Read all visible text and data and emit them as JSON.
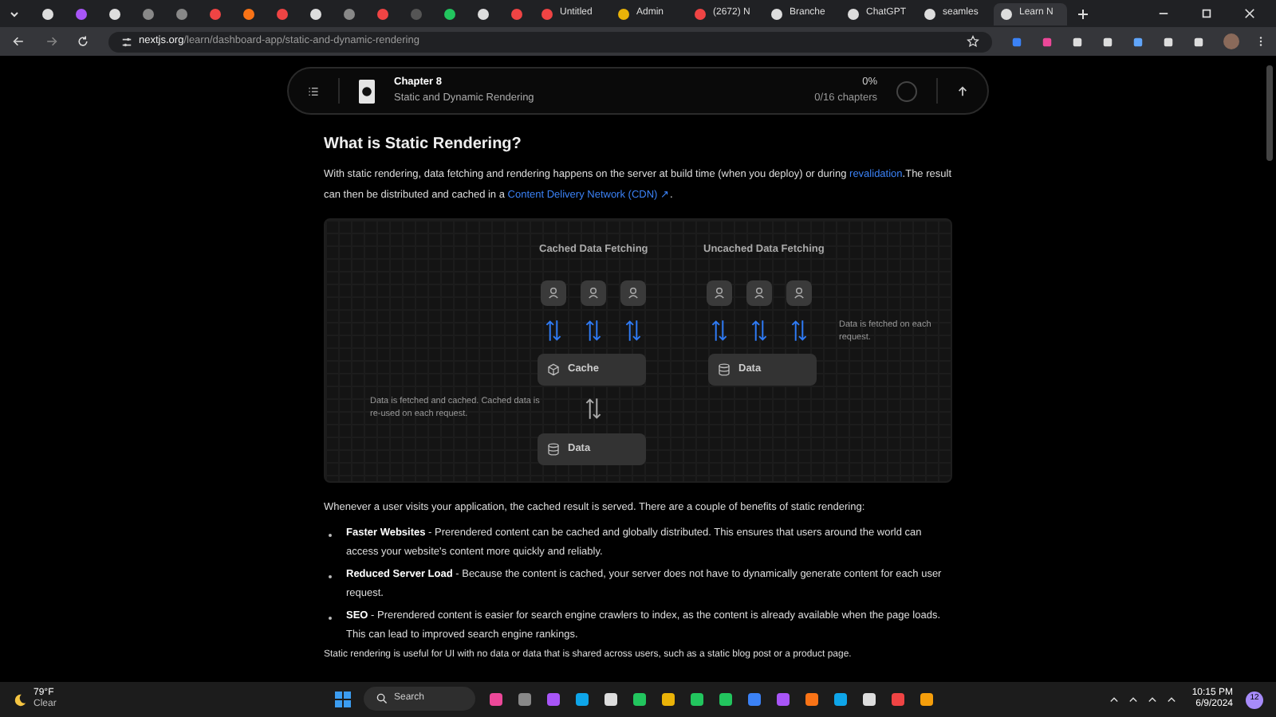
{
  "browser": {
    "tabs": [
      {
        "selected": false
      },
      {
        "selected": false
      },
      {
        "selected": false
      },
      {
        "selected": false
      },
      {
        "selected": false
      },
      {
        "selected": false
      },
      {
        "selected": false
      },
      {
        "selected": false
      },
      {
        "selected": false
      },
      {
        "selected": false
      },
      {
        "selected": false
      },
      {
        "selected": false
      },
      {
        "selected": false
      },
      {
        "selected": false
      },
      {
        "selected": false
      },
      {
        "label": "Untitled",
        "selected": false
      },
      {
        "label": "Admin",
        "selected": false
      },
      {
        "label": "(2672) N",
        "selected": false
      },
      {
        "label": "Branche",
        "selected": false
      },
      {
        "label": "ChatGPT",
        "selected": false
      },
      {
        "label": "seamles",
        "selected": false
      },
      {
        "label": "Learn N",
        "selected": true
      }
    ],
    "url_host": "nextjs.org",
    "url_path": "/learn/dashboard-app/static-and-dynamic-rendering"
  },
  "chapter_bar": {
    "chapter": "Chapter 8",
    "title": "Static and Dynamic Rendering",
    "progress": "0%",
    "count": "0/16 chapters"
  },
  "heading": "What is Static Rendering?",
  "intro": [
    {
      "text": "With static rendering, data fetching and rendering happens on the server at build time (when you deploy) or during ",
      "kind": "text"
    },
    {
      "text": "revalidation",
      "kind": "link"
    },
    {
      "text": ".",
      "kind": "text"
    },
    {
      "text": "The result can then be distributed and cached in a ",
      "kind": "text"
    },
    {
      "text": "Content Delivery Network (CDN) ↗",
      "kind": "link"
    },
    {
      "text": ".",
      "kind": "text"
    }
  ],
  "diagram": {
    "cached_title": "Cached Data Fetching",
    "uncached_title": "Uncached Data Fetching",
    "cache_label": "Cache",
    "cached_data_label": "Data",
    "uncached_data_label": "Data",
    "cached_note": "Data is fetched and cached. Cached data is re-used on each request.",
    "uncached_note": "Data is fetched on each request."
  },
  "benefits_intro": "Whenever a user visits your application, the cached result is served. There are a couple of benefits of static rendering:",
  "benefits": [
    {
      "title": "Faster Websites",
      "text": " - Prerendered content can be cached and globally distributed. This ensures that users around the world can access your website's content more quickly and reliably."
    },
    {
      "title": "Reduced Server Load",
      "text": " - Because the content is cached, your server does not have to dynamically generate content for each user request."
    },
    {
      "title": "SEO",
      "text": " - Prerendered content is easier for search engine crawlers to index, as the content is already available when the page loads. This can lead to improved search engine rankings."
    }
  ],
  "cut_text": "Static rendering is useful for UI with no data or data that is shared across users, such as a static blog post or a product page.",
  "taskbar": {
    "temperature": "79°F",
    "condition": "Clear",
    "search": "Search",
    "time": "10:15 PM",
    "date": "6/9/2024",
    "badge": "12"
  }
}
